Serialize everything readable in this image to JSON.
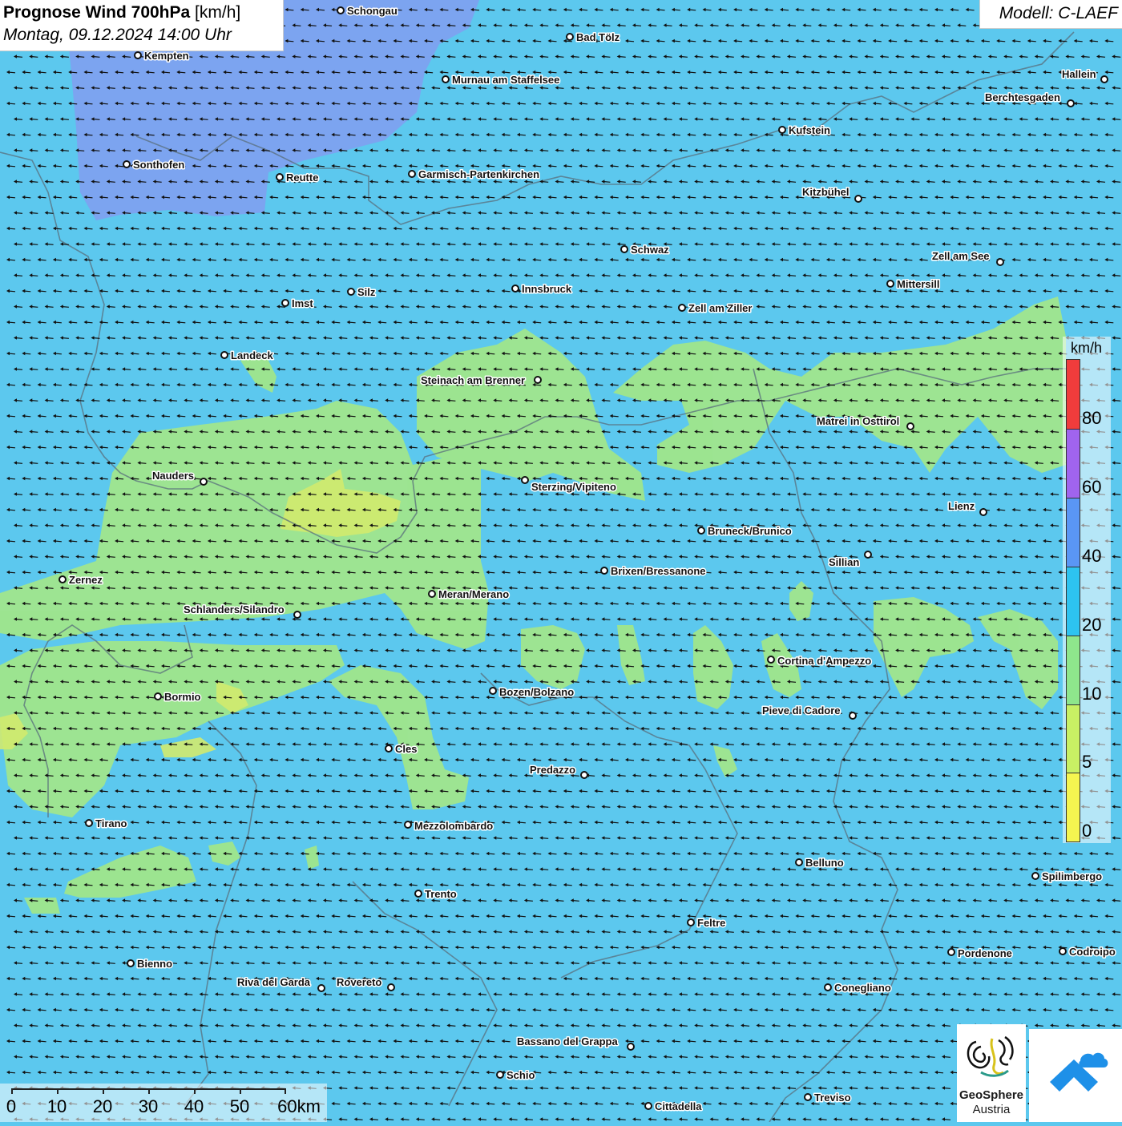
{
  "header": {
    "title_bold": "Prognose Wind 700hPa",
    "title_unit": "[km/h]",
    "datetime": "Montag, 09.12.2024 14:00 Uhr",
    "model": "Modell: C-LAEF"
  },
  "legend": {
    "unit": "km/h",
    "ticks": [
      "80",
      "60",
      "40",
      "20",
      "10",
      "5",
      "0"
    ],
    "colors": [
      "#f03c3c",
      "#a064ee",
      "#5a96f5",
      "#2dc3f0",
      "#8ee68c",
      "#c8f064",
      "#f5f550"
    ]
  },
  "map_colors": {
    "base_wind_10_20": "#5cc8ee",
    "wind_20_40_band": "#7fa0f0",
    "wind_5_10_zone": "#a0e68c",
    "wind_0_5_zone": "#d2ea6e"
  },
  "wind_direction": "east",
  "cities": [
    {
      "name": "Schongau"
    },
    {
      "name": "Bad Tölz"
    },
    {
      "name": "Kempten"
    },
    {
      "name": "Murnau am Staffelsee"
    },
    {
      "name": "Hallein"
    },
    {
      "name": "Berchtesgaden"
    },
    {
      "name": "Kufstein"
    },
    {
      "name": "Sonthofen"
    },
    {
      "name": "Reutte"
    },
    {
      "name": "Garmisch-Partenkirchen"
    },
    {
      "name": "Kitzbühel"
    },
    {
      "name": "Schwaz"
    },
    {
      "name": "Zell am See"
    },
    {
      "name": "Mittersill"
    },
    {
      "name": "Innsbruck"
    },
    {
      "name": "Silz"
    },
    {
      "name": "Imst"
    },
    {
      "name": "Zell am Ziller"
    },
    {
      "name": "Landeck"
    },
    {
      "name": "Steinach am Brenner"
    },
    {
      "name": "Matrei in Osttirol"
    },
    {
      "name": "Nauders"
    },
    {
      "name": "Sterzing/Vipiteno"
    },
    {
      "name": "Lienz"
    },
    {
      "name": "Bruneck/Brunico"
    },
    {
      "name": "Sillian"
    },
    {
      "name": "Brixen/Bressanone"
    },
    {
      "name": "Zernez"
    },
    {
      "name": "Meran/Merano"
    },
    {
      "name": "Schlanders/Silandro"
    },
    {
      "name": "Cortina d'Ampezzo"
    },
    {
      "name": "Bozen/Bolzano"
    },
    {
      "name": "Bormio"
    },
    {
      "name": "Pieve di Cadore"
    },
    {
      "name": "Cles"
    },
    {
      "name": "Predazzo"
    },
    {
      "name": "Tirano"
    },
    {
      "name": "Mezzolombardo"
    },
    {
      "name": "Belluno"
    },
    {
      "name": "Spilimbergo"
    },
    {
      "name": "Trento"
    },
    {
      "name": "Feltre"
    },
    {
      "name": "Pordenone"
    },
    {
      "name": "Codroipo"
    },
    {
      "name": "Bienno"
    },
    {
      "name": "Riva del Garda"
    },
    {
      "name": "Rovereto"
    },
    {
      "name": "Conegliano"
    },
    {
      "name": "Bassano del Grappa"
    },
    {
      "name": "Schio"
    },
    {
      "name": "Treviso"
    },
    {
      "name": "Cittadella"
    }
  ],
  "scale": {
    "labels": [
      "0",
      "10",
      "20",
      "30",
      "40",
      "50",
      "60km"
    ]
  },
  "logos": {
    "geosphere_line1": "GeoSphere",
    "geosphere_line2": "Austria"
  }
}
